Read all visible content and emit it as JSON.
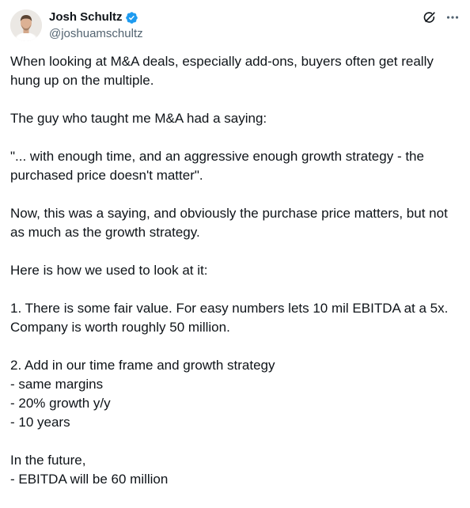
{
  "author": {
    "display_name": "Josh Schultz",
    "handle": "@joshuamschultz",
    "verified": true
  },
  "icons": {
    "verified": "verified-badge-icon",
    "grok": "grok-icon",
    "more": "more-options-icon"
  },
  "colors": {
    "text": "#0f1419",
    "secondary": "#536471",
    "verified_blue": "#1d9bf0"
  },
  "post": {
    "p1": "When looking at M&A deals, especially add-ons, buyers often get really hung up on the multiple.",
    "p2": "The guy who taught me M&A had a saying:",
    "p3": "\"... with enough time, and an aggressive enough growth strategy - the purchased price doesn't matter\".",
    "p4": "Now, this was a saying, and obviously the purchase price matters, but not as much as the growth strategy.",
    "p5": "Here is how we used to look at it:",
    "p6": "1. There is some fair value. For easy numbers lets 10 mil EBITDA at a 5x. Company is worth roughly 50 million.",
    "p7_lines": [
      "2. Add in our time frame and growth strategy",
      "- same margins",
      "- 20% growth y/y",
      "- 10 years"
    ],
    "p8_lines": [
      "In the future,",
      "- EBITDA will be 60 million"
    ]
  }
}
